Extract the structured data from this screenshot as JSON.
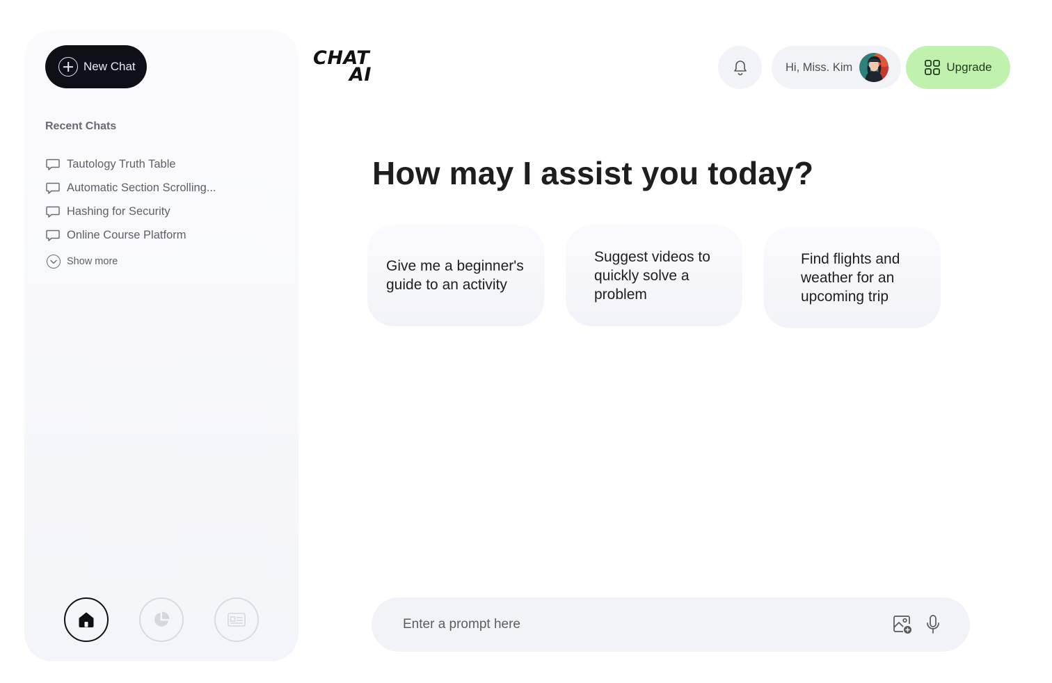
{
  "app": {
    "logo_line1": "CHAT",
    "logo_line2": "AI"
  },
  "sidebar": {
    "new_chat_label": "New Chat",
    "recent_title": "Recent Chats",
    "recent_chats": [
      "Tautology Truth Table",
      "Automatic Section Scrolling...",
      "Hashing for Security",
      "Online Course Platform"
    ],
    "show_more_label": "Show more",
    "nav": [
      "home-icon",
      "pie-chart-icon",
      "news-icon"
    ]
  },
  "header": {
    "greeting": "Hi, Miss. Kim",
    "upgrade_label": "Upgrade",
    "icons": [
      "bell-icon",
      "grid-icon"
    ]
  },
  "main": {
    "title": "How may I assist you today?",
    "suggestions": [
      "Give me a beginner's guide to an activity",
      "Suggest videos to quickly solve a problem",
      "Find flights and weather for an upcoming trip"
    ],
    "prompt_placeholder": "Enter a prompt here",
    "prompt_icons": [
      "image-add-icon",
      "microphone-icon"
    ]
  },
  "colors": {
    "primary_dark": "#0f0f17",
    "upgrade_green": "#c1f2ad",
    "surface": "#f2f3f8"
  }
}
